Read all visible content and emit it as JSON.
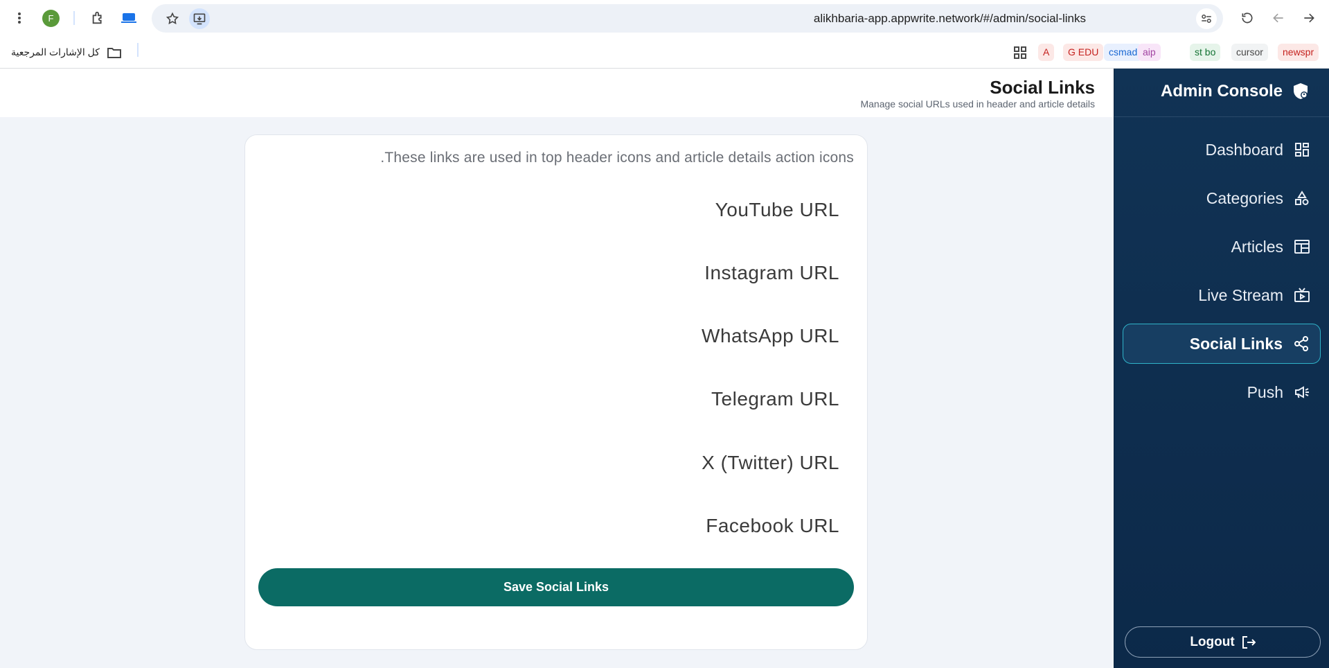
{
  "browser": {
    "url": "alikhbaria-app.appwrite.network/#/admin/social-links",
    "profile_initial": "F",
    "bookmarks_all_label": "كل الإشارات المرجعية",
    "bookmarks": [
      {
        "label": "A",
        "color": "#c5221f",
        "bg": "#fce8e6"
      },
      {
        "label": "G EDU",
        "color": "#c5221f",
        "bg": "#fce8e6"
      },
      {
        "label": "csmad",
        "color": "#1967d2",
        "bg": "#e8f0fe"
      },
      {
        "label": "aip",
        "color": "#a142a1",
        "bg": "#f8e5f8"
      },
      {
        "label": "st bo",
        "color": "#137333",
        "bg": "#e6f4ea"
      },
      {
        "label": "cursor",
        "color": "#474747",
        "bg": "#f1f3f4"
      },
      {
        "label": "newspr",
        "color": "#c5221f",
        "bg": "#fce8e6"
      }
    ]
  },
  "header": {
    "title": "Social Links",
    "subtitle": "Manage social URLs used in header and article details"
  },
  "card": {
    "description": ".These links are used in top header icons and article details action icons",
    "fields": [
      "YouTube URL",
      "Instagram URL",
      "WhatsApp URL",
      "Telegram URL",
      "X (Twitter) URL",
      "Facebook URL"
    ],
    "save_label": "Save Social Links"
  },
  "sidebar": {
    "brand": "Admin Console",
    "items": [
      {
        "label": "Dashboard",
        "icon": "dashboard-icon"
      },
      {
        "label": "Categories",
        "icon": "categories-icon"
      },
      {
        "label": "Articles",
        "icon": "articles-icon"
      },
      {
        "label": "Live Stream",
        "icon": "live-stream-icon"
      },
      {
        "label": "Social Links",
        "icon": "share-icon",
        "active": true
      },
      {
        "label": "Push",
        "icon": "megaphone-icon"
      }
    ],
    "logout_label": "Logout"
  },
  "colors": {
    "accent": "#0b6b64",
    "sidebar_bg": "#113355",
    "active_border": "#2fb3c9"
  }
}
